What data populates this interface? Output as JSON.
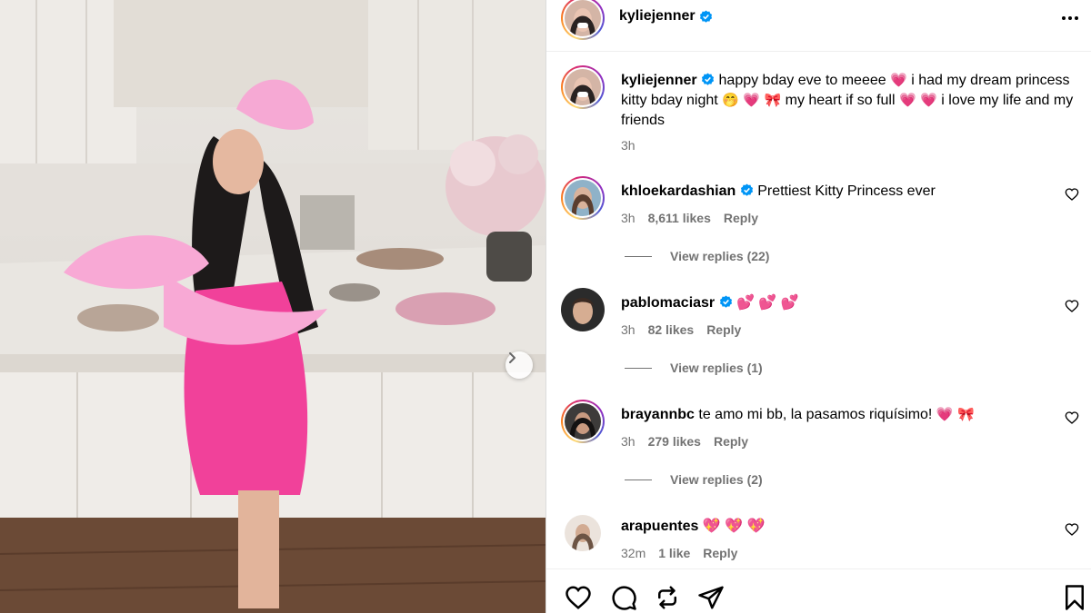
{
  "post": {
    "author": "kyliejenner",
    "caption_parts": [
      "happy bday eve to meeee",
      "i had my dream princess kitty bday night",
      "my heart if so full",
      "i love my life and my friends"
    ],
    "caption_time": "3h"
  },
  "comments": [
    {
      "username": "khloekardashian",
      "verified": true,
      "text": "Prettiest Kitty Princess ever",
      "time": "3h",
      "likes": "8,611 likes",
      "reply_label": "Reply",
      "view_replies": "View replies (22)"
    },
    {
      "username": "pablomaciasr",
      "verified": true,
      "text": "💕 💕 💕",
      "time": "3h",
      "likes": "82 likes",
      "reply_label": "Reply",
      "view_replies": "View replies (1)"
    },
    {
      "username": "brayannbc",
      "verified": false,
      "text": "te amo mi bb, la pasamos riquísimo!",
      "time": "3h",
      "likes": "279 likes",
      "reply_label": "Reply",
      "view_replies": "View replies (2)"
    },
    {
      "username": "arapuentes",
      "verified": false,
      "text": "💖 💖 💖",
      "time": "32m",
      "likes": "1 like",
      "reply_label": "Reply"
    }
  ],
  "icons": {
    "verified": "verified-badge-icon",
    "like": "heart-icon",
    "comment": "comment-icon",
    "share": "repost-icon",
    "send": "send-icon",
    "save": "bookmark-icon",
    "more": "more-options-icon",
    "next": "chevron-right-icon"
  },
  "colors": {
    "verified_blue": "#0095f6",
    "muted_text": "#737373",
    "heart_pink": "#ff3fa4"
  }
}
